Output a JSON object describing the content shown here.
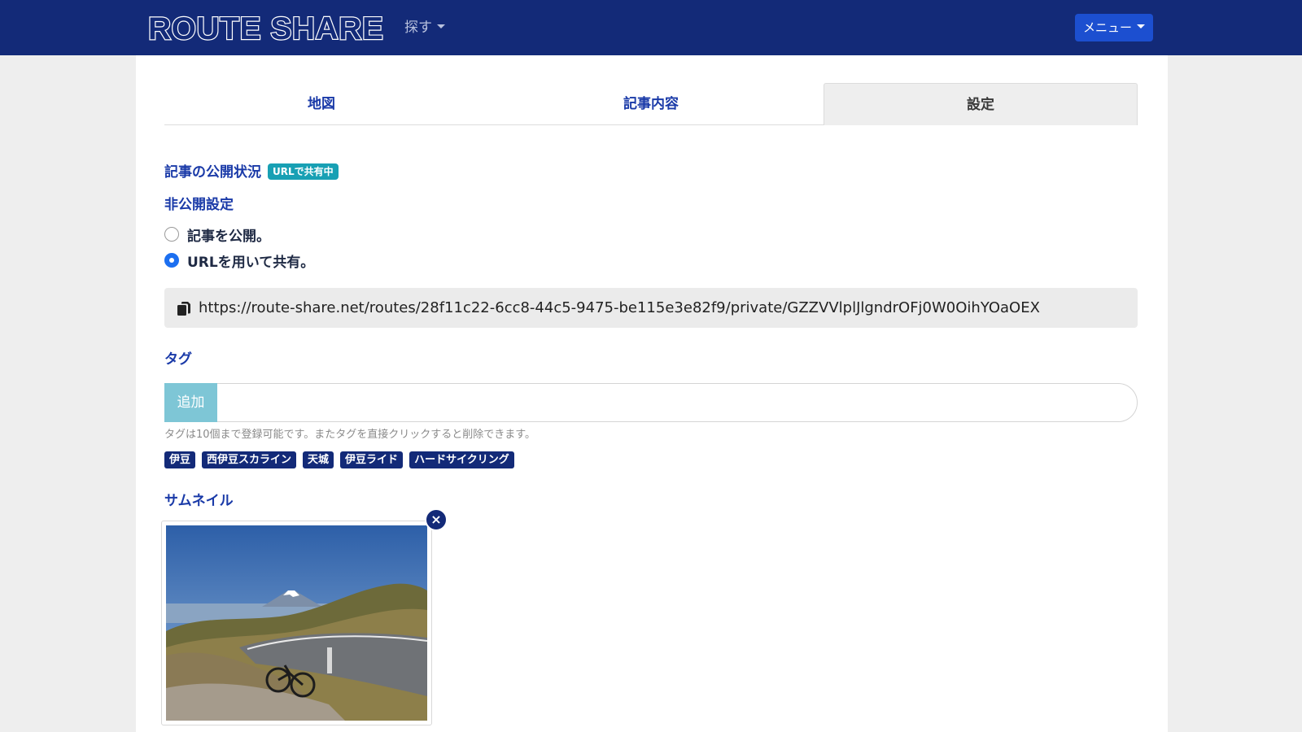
{
  "header": {
    "brand": "ROUTE SHARE",
    "explore_label": "探す",
    "menu_label": "メニュー"
  },
  "tabs": [
    {
      "label": "地図",
      "active": false
    },
    {
      "label": "記事内容",
      "active": false
    },
    {
      "label": "設定",
      "active": true
    }
  ],
  "publish_status": {
    "title": "記事の公開状況",
    "badge": "URLで共有中"
  },
  "privacy": {
    "title": "非公開設定",
    "options": [
      {
        "label": "記事を公開。",
        "checked": false
      },
      {
        "label": "URLを用いて共有。",
        "checked": true
      }
    ],
    "share_url": "https://route-share.net/routes/28f11c22-6cc8-44c5-9475-be115e3e82f9/private/GZZVVlplJlgndrOFj0W0OihYOaOEX"
  },
  "tags_section": {
    "title": "タグ",
    "add_label": "追加",
    "input_value": "",
    "help_text": "タグは10個まで登録可能です。またタグを直接クリックすると削除できます。",
    "tags": [
      "伊豆",
      "西伊豆スカライン",
      "天城",
      "伊豆ライド",
      "ハードサイクリング"
    ]
  },
  "thumbnail": {
    "title": "サムネイル",
    "remove_label": "×"
  },
  "colors": {
    "navbar": "#132a78",
    "accent": "#1a3aa8",
    "badge": "#18a0b4",
    "add_button": "#7ec6d6",
    "menu_button": "#1c4fd0"
  }
}
